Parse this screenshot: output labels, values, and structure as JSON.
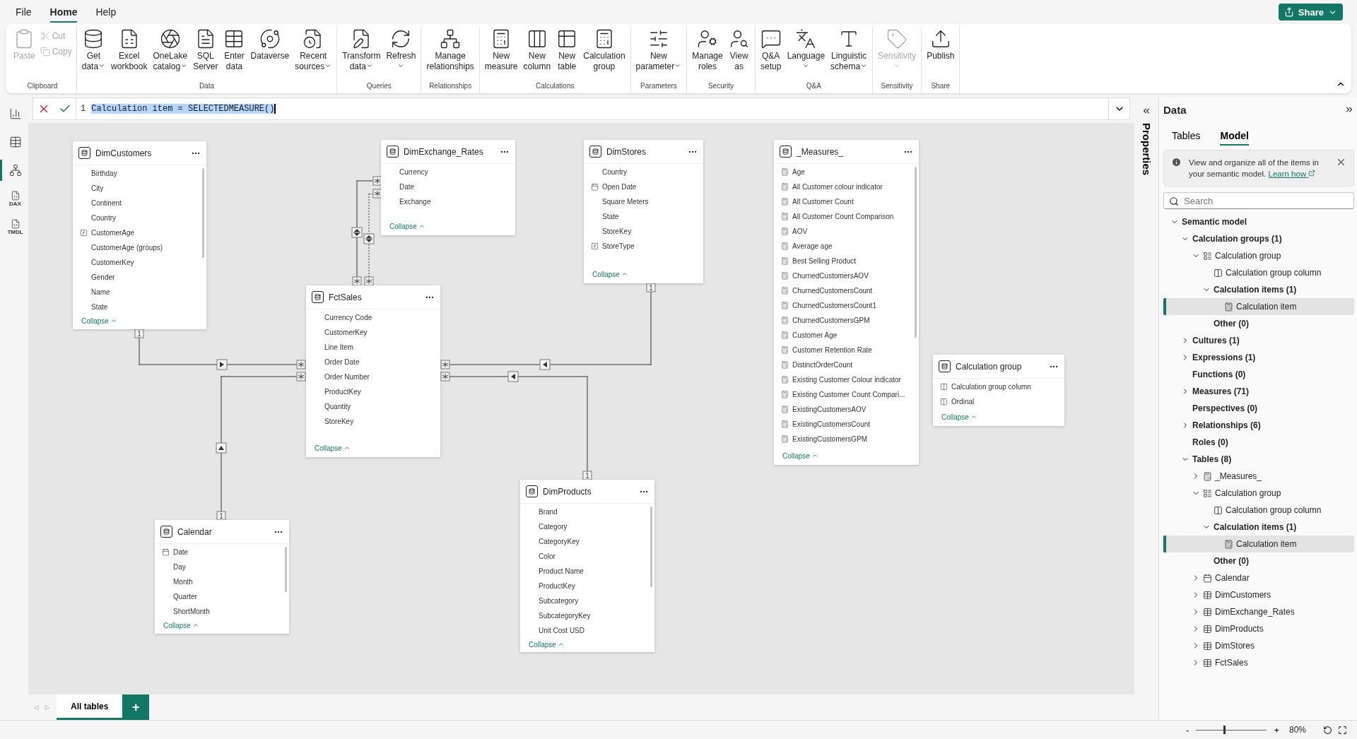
{
  "menu": [
    {
      "label": "File",
      "selected": false
    },
    {
      "label": "Home",
      "selected": true
    },
    {
      "label": "Help",
      "selected": false
    }
  ],
  "share_button": "Share",
  "ribbon": [
    {
      "label": "Clipboard",
      "buttons": [
        {
          "lines": [
            "Paste"
          ],
          "kind": "large",
          "disabled": true,
          "dropdown": false
        },
        {
          "lines": [
            "Cut"
          ],
          "kind": "small",
          "disabled": true,
          "dropdown": false
        },
        {
          "lines": [
            "Copy"
          ],
          "kind": "small",
          "disabled": true,
          "dropdown": false
        }
      ]
    },
    {
      "label": "Data",
      "buttons": [
        {
          "lines": [
            "Get",
            "data"
          ],
          "kind": "large",
          "disabled": false,
          "dropdown": true
        },
        {
          "lines": [
            "Excel",
            "workbook"
          ],
          "kind": "large",
          "disabled": false,
          "dropdown": false
        },
        {
          "lines": [
            "OneLake",
            "catalog"
          ],
          "kind": "large",
          "disabled": false,
          "dropdown": true
        },
        {
          "lines": [
            "SQL",
            "Server"
          ],
          "kind": "large",
          "disabled": false,
          "dropdown": false
        },
        {
          "lines": [
            "Enter",
            "data"
          ],
          "kind": "large",
          "disabled": false,
          "dropdown": false
        },
        {
          "lines": [
            "Dataverse"
          ],
          "kind": "large",
          "disabled": false,
          "dropdown": false
        },
        {
          "lines": [
            "Recent",
            "sources"
          ],
          "kind": "large",
          "disabled": false,
          "dropdown": true
        }
      ]
    },
    {
      "label": "Queries",
      "buttons": [
        {
          "lines": [
            "Transform",
            "data"
          ],
          "kind": "large",
          "disabled": false,
          "dropdown": true
        },
        {
          "lines": [
            "Refresh"
          ],
          "kind": "large",
          "disabled": false,
          "dropdown": true
        }
      ]
    },
    {
      "label": "Relationships",
      "buttons": [
        {
          "lines": [
            "Manage",
            "relationships"
          ],
          "kind": "large",
          "disabled": false,
          "dropdown": false
        }
      ]
    },
    {
      "label": "Calculations",
      "buttons": [
        {
          "lines": [
            "New",
            "measure"
          ],
          "kind": "large",
          "disabled": false,
          "dropdown": false
        },
        {
          "lines": [
            "New",
            "column"
          ],
          "kind": "large",
          "disabled": false,
          "dropdown": false
        },
        {
          "lines": [
            "New",
            "table"
          ],
          "kind": "large",
          "disabled": false,
          "dropdown": false
        },
        {
          "lines": [
            "Calculation",
            "group"
          ],
          "kind": "large",
          "disabled": false,
          "dropdown": false
        }
      ]
    },
    {
      "label": "Parameters",
      "buttons": [
        {
          "lines": [
            "New",
            "parameter"
          ],
          "kind": "large",
          "disabled": false,
          "dropdown": true
        }
      ]
    },
    {
      "label": "Security",
      "buttons": [
        {
          "lines": [
            "Manage",
            "roles"
          ],
          "kind": "large",
          "disabled": false,
          "dropdown": false
        },
        {
          "lines": [
            "View",
            "as"
          ],
          "kind": "large",
          "disabled": false,
          "dropdown": false
        }
      ]
    },
    {
      "label": "Q&A",
      "buttons": [
        {
          "lines": [
            "Q&A",
            "setup"
          ],
          "kind": "large",
          "disabled": false,
          "dropdown": false
        },
        {
          "lines": [
            "Language"
          ],
          "kind": "large",
          "disabled": false,
          "dropdown": true
        },
        {
          "lines": [
            "Linguistic",
            "schema"
          ],
          "kind": "large",
          "disabled": false,
          "dropdown": true
        }
      ]
    },
    {
      "label": "Sensitivity",
      "buttons": [
        {
          "lines": [
            "Sensitivity"
          ],
          "kind": "large",
          "disabled": true,
          "dropdown": true
        }
      ]
    },
    {
      "label": "Share",
      "buttons": [
        {
          "lines": [
            "Publish"
          ],
          "kind": "large",
          "disabled": false,
          "dropdown": false
        }
      ]
    }
  ],
  "rail": [
    {
      "kind": "report",
      "selected": false
    },
    {
      "kind": "table",
      "selected": false
    },
    {
      "kind": "model",
      "selected": true
    },
    {
      "kind": "file",
      "selected": false,
      "badge": "DAX"
    },
    {
      "kind": "file",
      "selected": false,
      "badge": "TMDL"
    }
  ],
  "formula": {
    "line": "1",
    "code": "Calculation item = SELECTEDMEASURE()",
    "selected": true
  },
  "tables": [
    {
      "title": "DimCustomers",
      "collapse": "Collapse",
      "fields": [
        {
          "name": "Birthday",
          "kind": "column"
        },
        {
          "name": "City",
          "kind": "column"
        },
        {
          "name": "Continent",
          "kind": "column"
        },
        {
          "name": "Country",
          "kind": "column"
        },
        {
          "name": "CustomerAge",
          "kind": "calculated"
        },
        {
          "name": "CustomerAge (groups)",
          "kind": "group"
        },
        {
          "name": "CustomerKey",
          "kind": "column"
        },
        {
          "name": "Gender",
          "kind": "column"
        },
        {
          "name": "Name",
          "kind": "column"
        },
        {
          "name": "State",
          "kind": "column"
        }
      ]
    },
    {
      "title": "DimExchange_Rates",
      "collapse": "Collapse",
      "fields": [
        {
          "name": "Currency",
          "kind": "column"
        },
        {
          "name": "Date",
          "kind": "column"
        },
        {
          "name": "Exchange",
          "kind": "column"
        }
      ]
    },
    {
      "title": "DimStores",
      "collapse": "Collapse",
      "fields": [
        {
          "name": "Country",
          "kind": "column"
        },
        {
          "name": "Open Date",
          "kind": "date"
        },
        {
          "name": "Square Meters",
          "kind": "column"
        },
        {
          "name": "State",
          "kind": "column"
        },
        {
          "name": "StoreKey",
          "kind": "column"
        },
        {
          "name": "StoreType",
          "kind": "calculated"
        }
      ]
    },
    {
      "title": "_Measures_",
      "collapse": "Collapse",
      "fields": [
        {
          "name": "Age",
          "kind": "measure"
        },
        {
          "name": "All Customer colour indicator",
          "kind": "measure"
        },
        {
          "name": "All Customer Count",
          "kind": "measure"
        },
        {
          "name": "All Customer Count Comparison",
          "kind": "measure"
        },
        {
          "name": "AOV",
          "kind": "measure"
        },
        {
          "name": "Average age",
          "kind": "measure"
        },
        {
          "name": "Best Selling Product",
          "kind": "measure"
        },
        {
          "name": "ChurnedCustomersAOV",
          "kind": "measure"
        },
        {
          "name": "ChurnedCustomersCount",
          "kind": "measure"
        },
        {
          "name": "ChurnedCustomersCount1",
          "kind": "measure"
        },
        {
          "name": "ChurnedCustomersGPM",
          "kind": "measure"
        },
        {
          "name": "Customer Age",
          "kind": "measure"
        },
        {
          "name": "Customer Retention Rate",
          "kind": "measure"
        },
        {
          "name": "DistinctOrderCount",
          "kind": "measure"
        },
        {
          "name": "Existing Customer Colour indicator",
          "kind": "measure"
        },
        {
          "name": "Existing Customer Count Compari...",
          "kind": "measure"
        },
        {
          "name": "ExistingCustomersAOV",
          "kind": "measure"
        },
        {
          "name": "ExistingCustomersCount",
          "kind": "measure"
        },
        {
          "name": "ExistingCustomersGPM",
          "kind": "measure"
        }
      ]
    },
    {
      "title": "FctSales",
      "collapse": "Collapse",
      "fields": [
        {
          "name": "Currency Code",
          "kind": "column"
        },
        {
          "name": "CustomerKey",
          "kind": "column"
        },
        {
          "name": "Line Item",
          "kind": "column"
        },
        {
          "name": "Order Date",
          "kind": "column"
        },
        {
          "name": "Order Number",
          "kind": "column"
        },
        {
          "name": "ProductKey",
          "kind": "column"
        },
        {
          "name": "Quantity",
          "kind": "column"
        },
        {
          "name": "StoreKey",
          "kind": "column"
        }
      ]
    },
    {
      "title": "Calculation group",
      "collapse": "Collapse",
      "fields": [
        {
          "name": "Calculation group column",
          "kind": "calc-column"
        },
        {
          "name": "Ordinal",
          "kind": "calc-column"
        }
      ]
    },
    {
      "title": "Calendar",
      "collapse": "Collapse",
      "fields": [
        {
          "name": "Date",
          "kind": "date"
        },
        {
          "name": "Day",
          "kind": "column"
        },
        {
          "name": "Month",
          "kind": "column"
        },
        {
          "name": "Quarter",
          "kind": "column"
        },
        {
          "name": "ShortMonth",
          "kind": "column"
        }
      ]
    },
    {
      "title": "DimProducts",
      "collapse": "Collapse",
      "fields": [
        {
          "name": "Brand",
          "kind": "column"
        },
        {
          "name": "Category",
          "kind": "column"
        },
        {
          "name": "CategoryKey",
          "kind": "column"
        },
        {
          "name": "Color",
          "kind": "column"
        },
        {
          "name": "Product Name",
          "kind": "column"
        },
        {
          "name": "ProductKey",
          "kind": "column"
        },
        {
          "name": "Subcategory",
          "kind": "column"
        },
        {
          "name": "SubcategoryKey",
          "kind": "column"
        },
        {
          "name": "Unit Cost USD",
          "kind": "column"
        }
      ]
    }
  ],
  "relationships": [
    {
      "one_label": "1",
      "active": true,
      "two_way": false
    },
    {
      "one_label": "1",
      "active": true,
      "two_way": false
    },
    {
      "one_label": "1",
      "active": true,
      "two_way": false
    },
    {
      "one_label": "1",
      "active": true,
      "two_way": false
    },
    {
      "active": true,
      "two_way": true
    },
    {
      "active": false,
      "two_way": true
    }
  ],
  "view_tabs": [
    {
      "label": "All tables",
      "selected": true
    }
  ],
  "add_tab": "+",
  "properties_label": "Properties",
  "data_panel": {
    "title": "Data",
    "tabs": [
      {
        "label": "Tables",
        "selected": false
      },
      {
        "label": "Model",
        "selected": true
      }
    ],
    "info": "View and organize all of the items in your semantic model.",
    "info_link": "Learn how",
    "search_placeholder": "Search",
    "tree": [
      {
        "label": "Semantic model",
        "kind": "folder",
        "expanded": true,
        "selected": false,
        "children": [
          {
            "label": "Calculation groups (1)",
            "kind": "folder",
            "expanded": true,
            "selected": false,
            "children": [
              {
                "label": "Calculation group",
                "kind": "calc-group",
                "expanded": true,
                "selected": false,
                "children": [
                  {
                    "label": "Calculation group column",
                    "kind": "column",
                    "selected": false
                  },
                  {
                    "label": "Calculation items (1)",
                    "kind": "folder",
                    "expanded": true,
                    "selected": false,
                    "children": [
                      {
                        "label": "Calculation item",
                        "kind": "calc-item",
                        "selected": true
                      }
                    ]
                  },
                  {
                    "label": "Other (0)",
                    "kind": "folder",
                    "selected": false
                  }
                ]
              }
            ]
          },
          {
            "label": "Cultures (1)",
            "kind": "folder",
            "expanded": false,
            "selected": false
          },
          {
            "label": "Expressions (1)",
            "kind": "folder",
            "expanded": false,
            "selected": false
          },
          {
            "label": "Functions (0)",
            "kind": "folder",
            "selected": false
          },
          {
            "label": "Measures (71)",
            "kind": "folder",
            "expanded": false,
            "selected": false
          },
          {
            "label": "Perspectives (0)",
            "kind": "folder",
            "selected": false
          },
          {
            "label": "Relationships (6)",
            "kind": "folder",
            "expanded": false,
            "selected": false
          },
          {
            "label": "Roles (0)",
            "kind": "folder",
            "selected": false
          },
          {
            "label": "Tables (8)",
            "kind": "folder",
            "expanded": true,
            "selected": false,
            "children": [
              {
                "label": "_Measures_",
                "kind": "measure-table",
                "expanded": false,
                "selected": false
              },
              {
                "label": "Calculation group",
                "kind": "calc-group",
                "expanded": true,
                "selected": false,
                "children": [
                  {
                    "label": "Calculation group column",
                    "kind": "column",
                    "selected": false
                  },
                  {
                    "label": "Calculation items (1)",
                    "kind": "folder",
                    "expanded": true,
                    "selected": false,
                    "children": [
                      {
                        "label": "Calculation item",
                        "kind": "calc-item",
                        "selected": true
                      }
                    ]
                  },
                  {
                    "label": "Other (0)",
                    "kind": "folder",
                    "selected": false
                  }
                ]
              },
              {
                "label": "Calendar",
                "kind": "date-table",
                "expanded": false,
                "selected": false
              },
              {
                "label": "DimCustomers",
                "kind": "table",
                "expanded": false,
                "selected": false
              },
              {
                "label": "DimExchange_Rates",
                "kind": "table",
                "expanded": false,
                "selected": false
              },
              {
                "label": "DimProducts",
                "kind": "table",
                "expanded": false,
                "selected": false
              },
              {
                "label": "DimStores",
                "kind": "table",
                "expanded": false,
                "selected": false
              },
              {
                "label": "FctSales",
                "kind": "table",
                "expanded": false,
                "selected": false
              }
            ]
          }
        ]
      }
    ]
  },
  "zoom": {
    "minus": "-",
    "plus": "+",
    "level": 0.39,
    "reading": "80%"
  }
}
